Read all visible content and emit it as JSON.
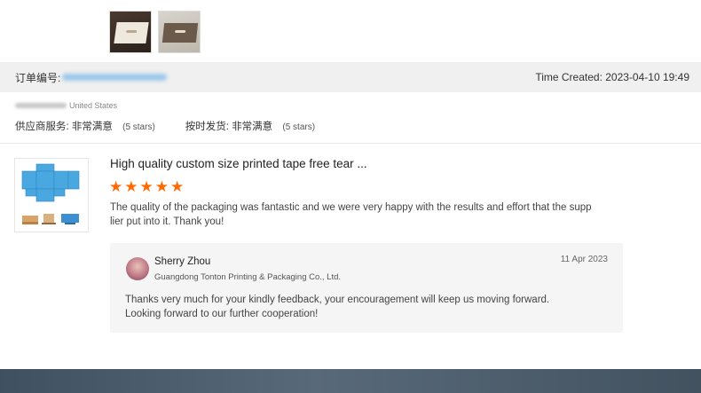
{
  "order": {
    "label": "订单编号:",
    "time_created": "Time Created: 2023-04-10 19:49"
  },
  "buyer": {
    "country": "United States"
  },
  "ratings": [
    {
      "label": "供应商服务:",
      "value": "非常满意",
      "stars": "(5 stars)"
    },
    {
      "label": "按时发货:",
      "value": "非常满意",
      "stars": "(5 stars)"
    }
  ],
  "review": {
    "title": "High quality custom size printed tape free tear ...",
    "stars": 5,
    "star_color": "#ff6a00",
    "text": "The quality of the packaging was fantastic and we were very happy with the results and effort that the supp lier put into it. Thank you!"
  },
  "reply": {
    "name": "Sherry Zhou",
    "company": "Guangdong Tonton Printing & Packaging Co., Ltd.",
    "date": "11 Apr 2023",
    "line1": "Thanks very much for your kindly feedback, your encouragement will keep us moving forward.",
    "line2": "Looking forward to our further cooperation!"
  },
  "icons": {
    "star": "star-icon"
  }
}
